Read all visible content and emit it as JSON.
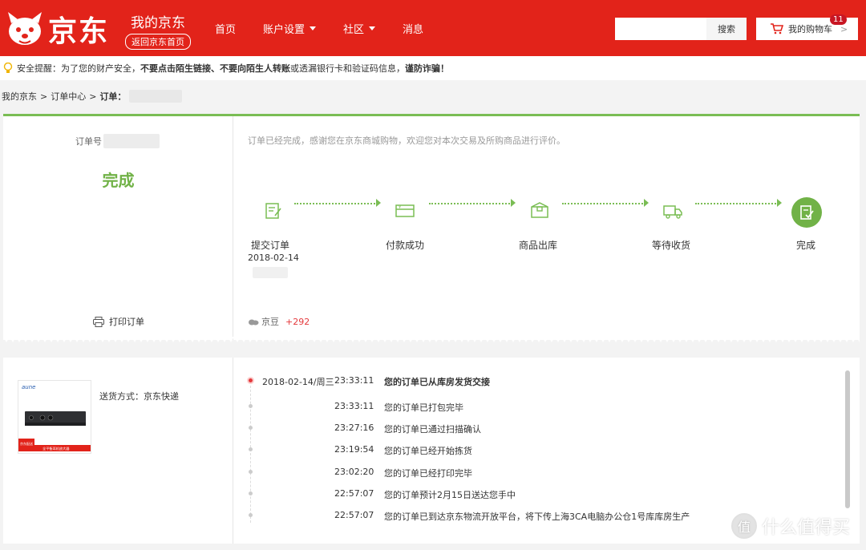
{
  "header": {
    "logo_text": "京东",
    "myjd_title": "我的京东",
    "myjd_back": "返回京东首页",
    "nav": [
      {
        "label": "首页",
        "has_caret": false
      },
      {
        "label": "账户设置",
        "has_caret": true
      },
      {
        "label": "社区",
        "has_caret": true
      },
      {
        "label": "消息",
        "has_caret": false
      }
    ],
    "search_placeholder": "",
    "search_button": "搜索",
    "cart_label": "我的购物车",
    "cart_count": "11",
    "cart_arrow": ">"
  },
  "notice": {
    "prefix": "安全提醒：为了您的财产安全，",
    "bold1": "不要点击陌生链接、不要向陌生人转账",
    "middle": "或透漏银行卡和验证码信息，",
    "bold2": "谨防诈骗！"
  },
  "breadcrumb": {
    "items": [
      "我的京东",
      "订单中心",
      "订单："
    ],
    "sep": ">"
  },
  "order": {
    "number_label": "订单号",
    "status": "完成",
    "print_label": "打印订单",
    "message": "订单已经完成，感谢您在京东商城购物，欢迎您对本次交易及所购商品进行评价。",
    "steps": [
      {
        "label": "提交订单",
        "date": "2018-02-14"
      },
      {
        "label": "付款成功",
        "date": ""
      },
      {
        "label": "商品出库",
        "date": ""
      },
      {
        "label": "等待收货",
        "date": ""
      },
      {
        "label": "完成",
        "date": ""
      }
    ],
    "beans_label": "京豆",
    "beans_count": "+292"
  },
  "logistics": {
    "product_brand": "aune",
    "product_tag": "京东配送",
    "product_caption": "全平衡耳机放大器",
    "delivery": "送货方式：京东快递",
    "timeline": [
      {
        "date": "2018-02-14/周三",
        "time": "23:33:11",
        "text": "您的订单已从库房发货交接"
      },
      {
        "date": "",
        "time": "23:33:11",
        "text": "您的订单已打包完毕"
      },
      {
        "date": "",
        "time": "23:27:16",
        "text": "您的订单已通过扫描确认"
      },
      {
        "date": "",
        "time": "23:19:54",
        "text": "您的订单已经开始拣货"
      },
      {
        "date": "",
        "time": "23:02:20",
        "text": "您的订单已经打印完毕"
      },
      {
        "date": "",
        "time": "22:57:07",
        "text": "您的订单预计2月15日送达您手中"
      },
      {
        "date": "",
        "time": "22:57:07",
        "text": "您的订单已到达京东物流开放平台，将下传上海3CA电脑办公仓1号库库房生产"
      }
    ]
  },
  "watermark": {
    "icon_char": "值",
    "text": "什么值得买"
  },
  "colors": {
    "brand_red": "#e2231a",
    "success_green": "#71b247",
    "accent_red": "#e4393c"
  }
}
